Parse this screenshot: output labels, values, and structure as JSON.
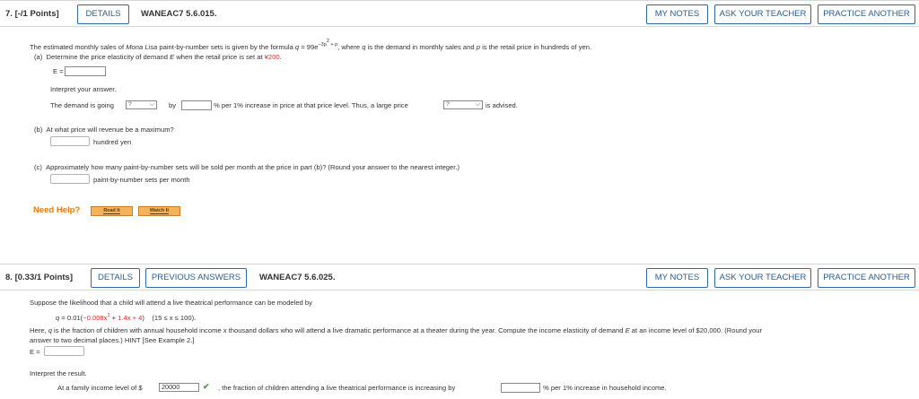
{
  "q7": {
    "number": "7.",
    "points": "[-/1 Points]",
    "details": "DETAILS",
    "id": "WANEAC7 5.6.015.",
    "my_notes": "MY NOTES",
    "ask_teacher": "ASK YOUR TEACHER",
    "practice_another": "PRACTICE ANOTHER",
    "intro_a": "The estimated monthly sales of ",
    "intro_italic": "Mona Lisa",
    "intro_b": " paint-by-number sets is given by the formula ",
    "formula_q": "q",
    "formula_eq": " = 99e",
    "formula_exp": "−3p",
    "formula_exp2": "2",
    "formula_exp3": " + p",
    "intro_c": ", where ",
    "intro_q": "q",
    "intro_d": " is the demand in monthly sales and ",
    "intro_p": "p",
    "intro_e": " is the retail price in hundreds of yen.",
    "part_a_label": "(a)",
    "part_a_text": "Determine the price elasticity of demand ",
    "part_a_E": "E",
    "part_a_text2": " when the retail price is set at ",
    "part_a_price": "¥200",
    "part_a_end": ".",
    "e_label": "E =",
    "interpret": "Interpret your answer.",
    "demand_going": "The demand is going",
    "select1": "?",
    "by": "by",
    "pct_text": "% per 1% increase in price at that price level. Thus, a large price",
    "select2": "?",
    "advised": "is advised.",
    "part_b_label": "(b)",
    "part_b_text": "At what price will revenue be a maximum?",
    "hundred_yen": "hundred yen",
    "part_c_label": "(c)",
    "part_c_text": "Approximately how many paint-by-number sets will be sold per month at the price in part (b)? (Round your answer to the nearest integer.)",
    "sets_per_month": "paint-by-number sets per month",
    "need_help": "Need Help?",
    "read_it": "Read It",
    "watch_it": "Watch It"
  },
  "q8": {
    "number": "8.",
    "points": "[0.33/1 Points]",
    "details": "DETAILS",
    "previous_answers": "PREVIOUS ANSWERS",
    "id": "WANEAC7 5.6.025.",
    "my_notes": "MY NOTES",
    "ask_teacher": "ASK YOUR TEACHER",
    "practice_another": "PRACTICE ANOTHER",
    "intro": "Suppose the likelihood that a child will attend a live theatrical performance can be modeled by",
    "f_q": "q",
    "f_a": " = 0.01(",
    "f_red1": "−0.008x",
    "f_red1_exp": "2",
    "f_mid": " + ",
    "f_red2": "1.4x + 4",
    "f_end": ")",
    "f_domain": "(15 ≤ x ≤ 100).",
    "here_a": "Here, ",
    "here_q": "q",
    "here_b": " is the fraction of children with annual household income ",
    "here_x": "x",
    "here_c": " thousand dollars who will attend a live dramatic performance at a theater during the year. Compute the income elasticity of demand ",
    "here_E": "E",
    "here_d": " at an income level of $20,000. (Round your",
    "here_line2": "answer to two decimal places.) HINT [See Example 2.]",
    "e_label": "E =",
    "interpret": "Interpret the result.",
    "family_income": "At a family income level of $",
    "income_value": "20000",
    "fraction_text": ", the fraction of children attending a live theatrical performance is increasing by",
    "pct_text": "% per 1% increase in household income."
  }
}
